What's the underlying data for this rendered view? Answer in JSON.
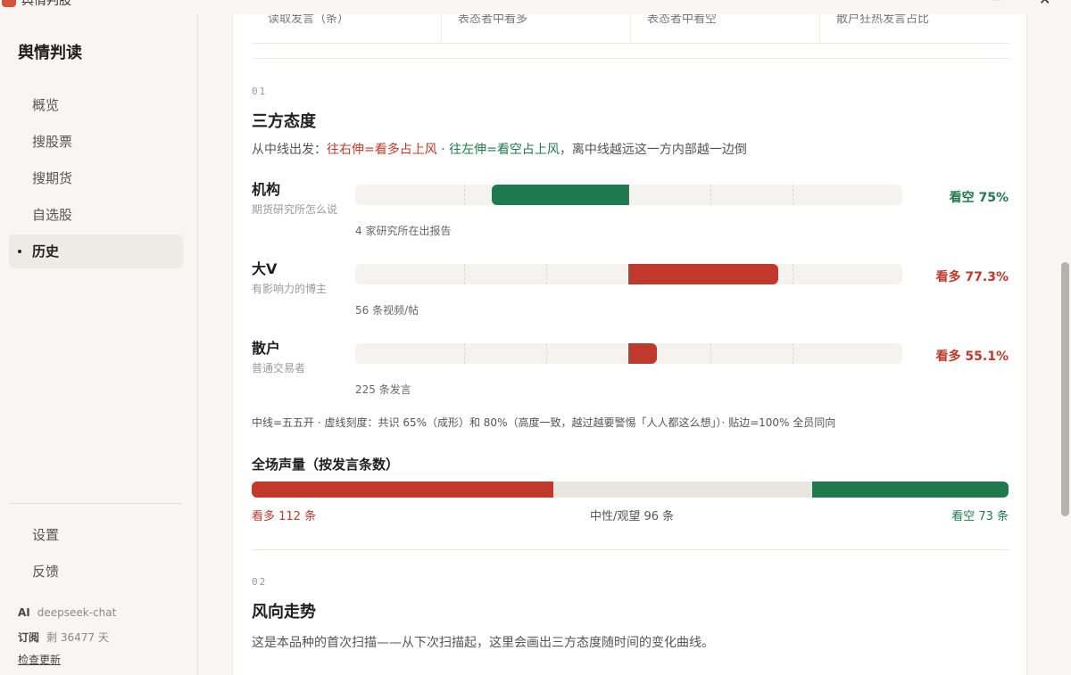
{
  "window": {
    "title": "舆情判股",
    "minimize_glyph": "─",
    "close_glyph": "✕"
  },
  "sidebar": {
    "brand": "舆情判读",
    "items": [
      {
        "label": "概览",
        "active": false
      },
      {
        "label": "搜股票",
        "active": false
      },
      {
        "label": "搜期货",
        "active": false
      },
      {
        "label": "自选股",
        "active": false
      },
      {
        "label": "历史",
        "active": true
      }
    ],
    "bottom_items": [
      {
        "label": "设置"
      },
      {
        "label": "反馈"
      }
    ],
    "ai_key": "AI",
    "ai_value": "deepseek-chat",
    "sub_key": "订阅",
    "sub_value": "剩 36477 天",
    "update_link": "检查更新"
  },
  "top_stats": [
    "读取发言（条）",
    "表态者中看多",
    "表态者中看空",
    "散户狂热发言占比"
  ],
  "section1": {
    "number": "01",
    "title": "三方态度",
    "desc_prefix": "从中线出发：",
    "desc_red": "往右伸=看多占上风",
    "desc_sep": " · ",
    "desc_green": "往左伸=看空占上风",
    "desc_suffix": "，离中线越远这一方内部越一边倒",
    "rows": [
      {
        "label": "机构",
        "sub": "期货研究所怎么说",
        "direction": "bear",
        "share_pct": 75,
        "pct_label": "看空 75%",
        "count": "4 家研究所在出报告"
      },
      {
        "label": "大V",
        "sub": "有影响力的博主",
        "direction": "bull",
        "share_pct": 77.3,
        "pct_label": "看多 77.3%",
        "count": "56 条视频/帖"
      },
      {
        "label": "散户",
        "sub": "普通交易者",
        "direction": "bull",
        "share_pct": 55.1,
        "pct_label": "看多 55.1%",
        "count": "225 条发言"
      }
    ],
    "note": "中线=五五开 · 虚线刻度：共识 65%（成形）和 80%（高度一致，越过越要警惕「人人都这么想」）· 贴边=100% 全员同向",
    "volume": {
      "title": "全场声量（按发言条数）",
      "bull": 112,
      "neutral": 96,
      "bear": 73,
      "bull_label": "看多 112 条",
      "neutral_label": "中性/观望 96 条",
      "bear_label": "看空 73 条"
    }
  },
  "section2": {
    "number": "02",
    "title": "风向走势",
    "desc": "这是本品种的首次扫描——从下次扫描起，这里会画出三方态度随时间的变化曲线。"
  },
  "colors": {
    "bull": "#c0392b",
    "bear": "#1e7a4d",
    "neutral": "#e7e6e0",
    "track": "#f4f3ef"
  }
}
